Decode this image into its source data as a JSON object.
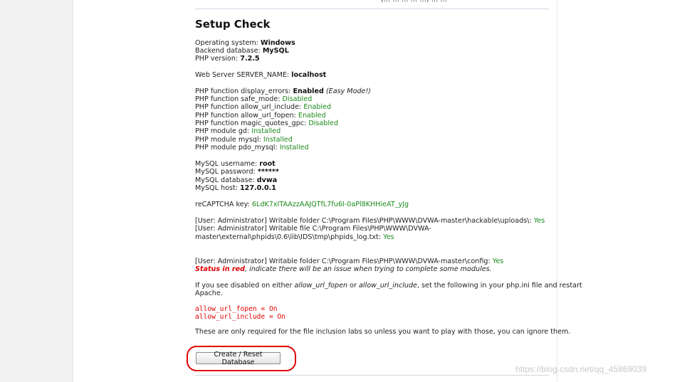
{
  "header": {
    "top_fragment": "(… … … … …) … …"
  },
  "page": {
    "title": "Setup Check"
  },
  "system": {
    "os_label": "Operating system: ",
    "os_value": "Windows",
    "db_label": "Backend database: ",
    "db_value": "MySQL",
    "php_label": "PHP version: ",
    "php_value": "7.2.5",
    "server_label": "Web Server SERVER_NAME: ",
    "server_value": "localhost"
  },
  "php_checks": [
    {
      "label": "PHP function display_errors: ",
      "value": "Enabled",
      "note": " (Easy Mode!)"
    },
    {
      "label": "PHP function safe_mode: ",
      "value": "Disabled"
    },
    {
      "label": "PHP function allow_url_include: ",
      "value": "Enabled"
    },
    {
      "label": "PHP function allow_url_fopen: ",
      "value": "Enabled"
    },
    {
      "label": "PHP function magic_quotes_gpc: ",
      "value": "Disabled"
    },
    {
      "label": "PHP module gd: ",
      "value": "Installed"
    },
    {
      "label": "PHP module mysql: ",
      "value": "Installed"
    },
    {
      "label": "PHP module pdo_mysql: ",
      "value": "Installed"
    }
  ],
  "mysql": {
    "user_label": "MySQL username: ",
    "user_value": "root",
    "pass_label": "MySQL password: ",
    "pass_value": "******",
    "db_label": "MySQL database: ",
    "db_value": "dvwa",
    "host_label": "MySQL host: ",
    "host_value": "127.0.0.1"
  },
  "recaptcha": {
    "label": "reCAPTCHA key: ",
    "value": "6LdK7xITAAzzAAJQTfL7fu6I-0aPl8KHHieAT_yJg"
  },
  "writable": {
    "uploads_label": "[User: Administrator] Writable folder C:\\Program Files\\PHP\\WWW\\DVWA-master\\hackable\\uploads\\: ",
    "uploads_value": "Yes",
    "phpids_label_1": "[User: Administrator] Writable file C:\\Program Files\\PHP\\WWW\\DVWA-",
    "phpids_label_2": "master\\external\\phpids\\0.6\\lib\\IDS\\tmp\\phpids_log.txt: ",
    "phpids_value": "Yes",
    "config_label": "[User: Administrator] Writable folder C:\\Program Files\\PHP\\WWW\\DVWA-master\\config: ",
    "config_value": "Yes"
  },
  "status_note": {
    "red": "Status in red",
    "rest": ", indicate there will be an issue when trying to complete some modules."
  },
  "disabled_note": {
    "part1": "If you see disabled on either ",
    "opt1": "allow_url_fopen",
    "part2": " or ",
    "opt2": "allow_url_include",
    "part3": ", set the following in your php.ini file and restart",
    "line2": "Apache."
  },
  "code": {
    "line1": "allow_url_fopen = On",
    "line2": "allow_url_include = On"
  },
  "footer_note": "These are only required for the file inclusion labs so unless you want to play with those, you can ignore them.",
  "actions": {
    "reset_button": "Create / Reset Database"
  },
  "watermark": "https://blog.csdn.net/qq_45869039",
  "colors": {
    "ok": "#1a8a1a",
    "bad": "#e00000",
    "ring": "#e00000"
  }
}
